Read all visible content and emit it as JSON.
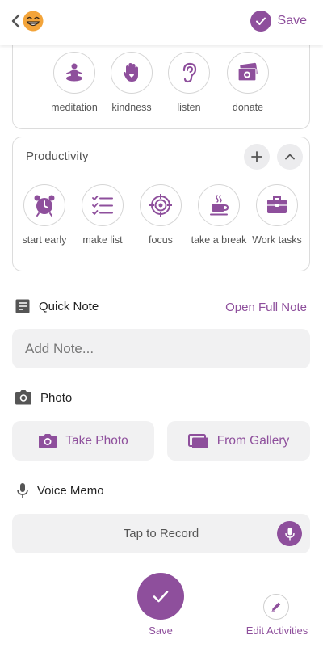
{
  "colors": {
    "accent": "#8e4f9c",
    "field_bg": "#f1f1f2"
  },
  "topbar": {
    "save_label": "Save",
    "back_icon": "chevron-left-icon",
    "mood_icon": "grinning-emoji-icon"
  },
  "wellness_activities": [
    {
      "label": "meditation",
      "icon": "meditation-icon"
    },
    {
      "label": "kindness",
      "icon": "hand-heart-icon"
    },
    {
      "label": "listen",
      "icon": "ear-icon"
    },
    {
      "label": "donate",
      "icon": "money-icon"
    }
  ],
  "productivity": {
    "title": "Productivity",
    "activities": [
      {
        "label": "start early",
        "icon": "alarm-clock-icon"
      },
      {
        "label": "make list",
        "icon": "checklist-icon"
      },
      {
        "label": "focus",
        "icon": "target-icon"
      },
      {
        "label": "take a break",
        "icon": "coffee-cup-icon"
      },
      {
        "label": "Work tasks",
        "icon": "briefcase-icon"
      }
    ]
  },
  "quick_note": {
    "title": "Quick Note",
    "open_full_label": "Open Full Note",
    "placeholder": "Add Note..."
  },
  "photo": {
    "title": "Photo",
    "take_photo_label": "Take Photo",
    "gallery_label": "From Gallery"
  },
  "voice_memo": {
    "title": "Voice Memo",
    "record_label": "Tap to Record"
  },
  "bottom": {
    "save_label": "Save",
    "edit_label": "Edit Activities"
  }
}
